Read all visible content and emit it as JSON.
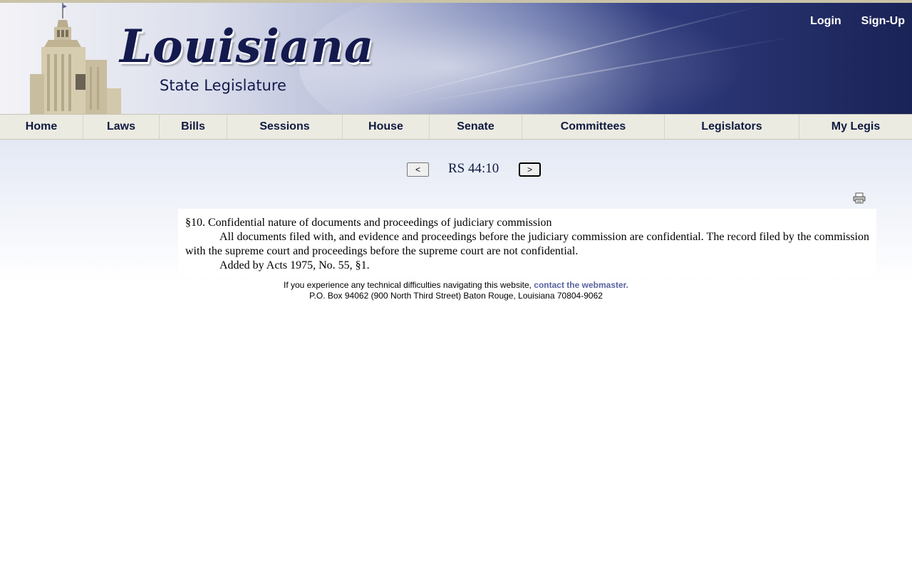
{
  "header": {
    "logo_title": "Louisiana",
    "logo_subtitle": "State Legislature",
    "login": "Login",
    "signup": "Sign-Up"
  },
  "nav": {
    "items": [
      {
        "label": "Home"
      },
      {
        "label": "Laws"
      },
      {
        "label": "Bills"
      },
      {
        "label": "Sessions"
      },
      {
        "label": "House"
      },
      {
        "label": "Senate"
      },
      {
        "label": "Committees"
      },
      {
        "label": "Legislators"
      },
      {
        "label": "My Legis"
      }
    ]
  },
  "pager": {
    "prev_label": "<",
    "title": "RS 44:10",
    "next_label": ">"
  },
  "print_icon": "printer-icon",
  "document": {
    "heading": "§10.  Confidential nature of documents and proceedings of judiciary commission",
    "body": "All documents filed with, and evidence and proceedings before the judiciary commission are confidential.  The record filed by the commission with the supreme court and proceedings before the supreme court are not confidential.",
    "history": "Added by Acts 1975, No. 55, §1."
  },
  "footer": {
    "notice": "If you experience any technical difficulties navigating this website, ",
    "contact_link": "contact the webmaster.",
    "address": "P.O. Box 94062 (900 North Third Street) Baton Rouge, Louisiana 70804-9062"
  },
  "colors": {
    "brand_navy": "#141a4e",
    "nav_bg": "#ecebe2",
    "link": "#5a62a0"
  }
}
